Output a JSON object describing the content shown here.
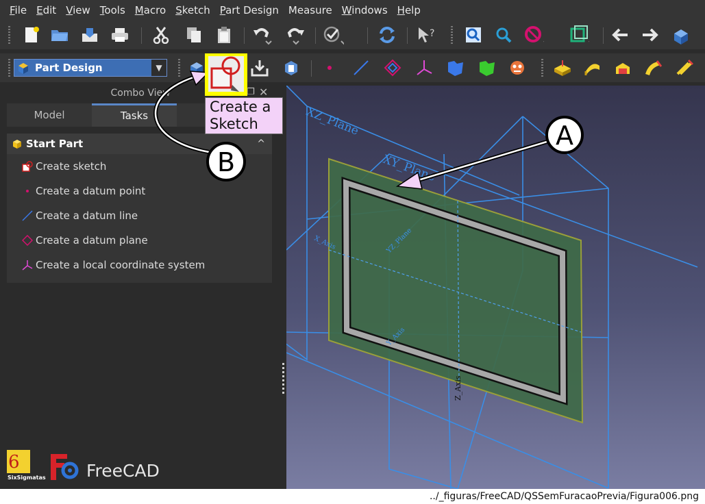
{
  "menubar": {
    "items": [
      {
        "u": "F",
        "rest": "ile"
      },
      {
        "u": "E",
        "rest": "dit"
      },
      {
        "u": "V",
        "rest": "iew"
      },
      {
        "u": "T",
        "rest": "ools"
      },
      {
        "u": "M",
        "rest": "acro"
      },
      {
        "u": "S",
        "rest": "ketch"
      },
      {
        "u": "P",
        "rest": "art Design"
      },
      {
        "u": "",
        "rest": "Measure"
      },
      {
        "u": "W",
        "rest": "indows"
      },
      {
        "u": "H",
        "rest": "elp"
      }
    ]
  },
  "workbench": {
    "selected": "Part Design"
  },
  "combo_view": {
    "title": "Combo View",
    "tabs": [
      "Model",
      "Tasks"
    ],
    "task_panel": {
      "header": "Start Part",
      "items": [
        "Create sketch",
        "Create a datum point",
        "Create a datum line",
        "Create a datum plane",
        "Create a local coordinate system"
      ]
    }
  },
  "tooltip": {
    "line1": "Create a",
    "line2": "Sketch"
  },
  "viewport": {
    "plane_labels": [
      "XZ_Plane",
      "XY_Plane",
      "YZ_Plane",
      "X_Axis",
      "Y_Axis",
      "Z_Axis"
    ]
  },
  "callouts": {
    "a": "A",
    "b": "B"
  },
  "branding": {
    "app": "FreeCAD",
    "logo_text": "SixSigmatas"
  },
  "footer": {
    "path": "../_figuras/FreeCAD/QSSemFuracaoPrevia/Figura006.png"
  },
  "colors": {
    "accent": "#3d6eb4",
    "highlight": "#ffff00",
    "tooltip_bg": "#f3d2f8",
    "plane": "#3a8ee6",
    "sketch": "#3f6a48"
  }
}
